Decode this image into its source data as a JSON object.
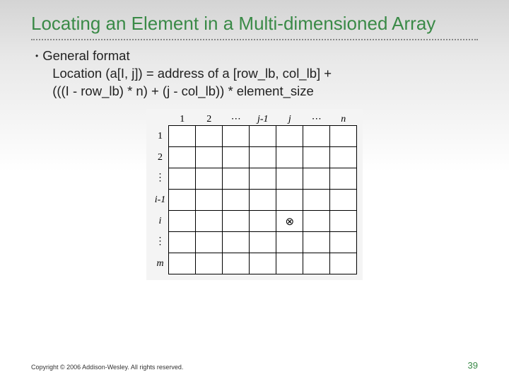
{
  "title": "Locating an Element in a Multi-dimensioned Array",
  "bullet": {
    "heading": "General format",
    "line1": "Location (a[I, j]) = address of a [row_lb, col_lb] +",
    "line2": "(((I - row_lb) * n) + (j - col_lb)) * element_size"
  },
  "grid": {
    "col_labels": [
      "1",
      "2",
      "⋯",
      "j-1",
      "j",
      "⋯",
      "n"
    ],
    "row_labels": [
      "1",
      "2",
      "⋮",
      "i-1",
      "i",
      "⋮",
      "m"
    ],
    "marker_symbol": "⊗",
    "marker_row_index": 4,
    "marker_col_index": 4
  },
  "footer": {
    "copyright": "Copyright © 2006 Addison-Wesley. All rights reserved.",
    "page": "39"
  }
}
